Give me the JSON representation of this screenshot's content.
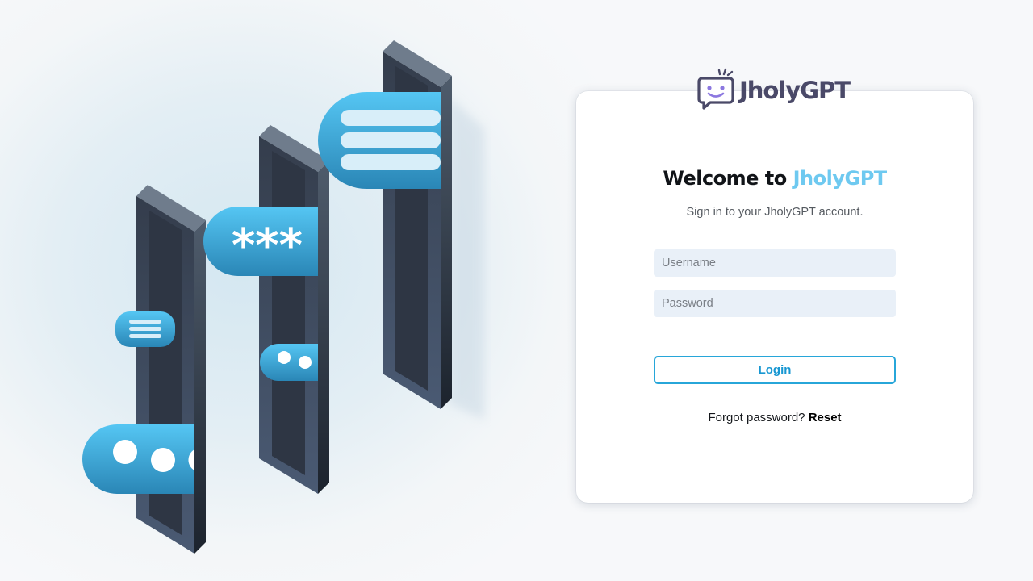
{
  "brand": {
    "name": "JholyGPT",
    "logo_icon": "smiley-chat-bubble-icon"
  },
  "login": {
    "welcome_prefix": "Welcome to",
    "welcome_accent": "JholyGPT",
    "subtitle": "Sign in to your JholyGPT account.",
    "username_placeholder": "Username",
    "password_placeholder": "Password",
    "login_label": "Login",
    "forgot_text": "Forgot password?",
    "reset_label": "Reset"
  },
  "illustration": {
    "bubble_glyphs": [
      "***",
      "•••",
      "••",
      "≡"
    ]
  },
  "colors": {
    "accent": "#6ec9f0",
    "button_border": "#27a6d9",
    "input_bg": "#e9f0f8",
    "brand_text": "#4a4968"
  }
}
